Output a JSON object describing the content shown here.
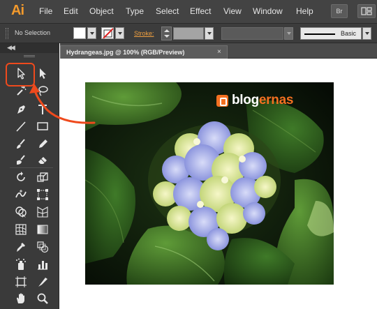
{
  "app": {
    "logo": "Ai",
    "menu": [
      "File",
      "Edit",
      "Object",
      "Type",
      "Select",
      "Effect",
      "View",
      "Window",
      "Help"
    ],
    "bridge_button": "Br"
  },
  "control_bar": {
    "selection_label": "No Selection",
    "stroke_label": "Stroke:",
    "brush_label": "Basic"
  },
  "tools": [
    "selection-tool",
    "direct-selection-tool",
    "magic-wand-tool",
    "lasso-tool",
    "pen-tool",
    "type-tool",
    "line-segment-tool",
    "rectangle-tool",
    "paintbrush-tool",
    "pencil-tool",
    "blob-brush-tool",
    "eraser-tool",
    "rotate-tool",
    "scale-tool",
    "width-tool",
    "free-transform-tool",
    "shape-builder-tool",
    "perspective-grid-tool",
    "mesh-tool",
    "gradient-tool",
    "eyedropper-tool",
    "blend-tool",
    "symbol-sprayer-tool",
    "column-graph-tool",
    "artboard-tool",
    "slice-tool",
    "hand-tool",
    "zoom-tool"
  ],
  "document": {
    "tab_title": "Hydrangeas.jpg @ 100% (RGB/Preview)",
    "close_glyph": "×"
  },
  "watermark": {
    "part1": "blog",
    "part2": "ernas"
  },
  "colors": {
    "accent": "#f39a2c",
    "annotation": "#ef4a1d",
    "watermark_orange": "#f37021"
  }
}
